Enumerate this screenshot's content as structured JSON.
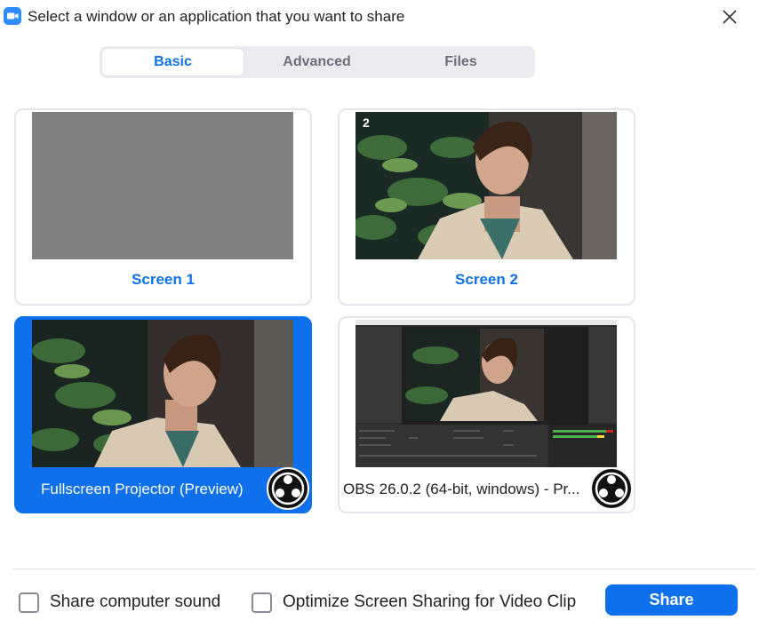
{
  "window": {
    "title": "Select a window or an application that you want to share",
    "app_icon": "zoom-camera-icon",
    "close_icon": "close-icon"
  },
  "tabs": [
    {
      "label": "Basic",
      "active": true
    },
    {
      "label": "Advanced",
      "active": false
    },
    {
      "label": "Files",
      "active": false
    }
  ],
  "sources": [
    {
      "label": "Screen 1",
      "type": "screen",
      "selected": false
    },
    {
      "label": "Screen 2",
      "type": "screen",
      "selected": false,
      "badge": "2"
    },
    {
      "label": "Fullscreen Projector (Preview)",
      "type": "window",
      "selected": true,
      "icon": "obs-icon"
    },
    {
      "label": "OBS 26.0.2 (64-bit, windows) - Pr...",
      "type": "window",
      "selected": false,
      "icon": "obs-icon"
    }
  ],
  "footer": {
    "share_sound_label": "Share computer sound",
    "share_sound_checked": false,
    "optimize_label": "Optimize Screen Sharing for Video Clip",
    "optimize_checked": false,
    "share_button_label": "Share"
  },
  "colors": {
    "accent": "#0e71eb",
    "zoom_blue": "#2d8cff",
    "placeholder_gray": "#808080"
  }
}
